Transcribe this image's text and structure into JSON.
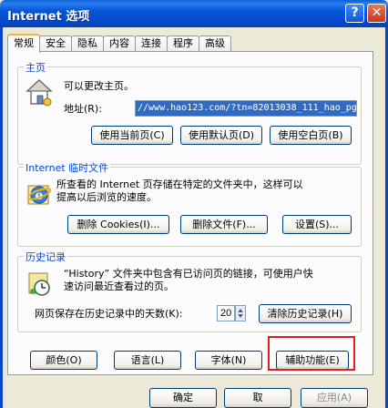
{
  "window": {
    "title": "Internet 选项",
    "help_glyph": "?",
    "close_glyph": "✕"
  },
  "tabs": [
    {
      "label": "常规",
      "active": true
    },
    {
      "label": "安全"
    },
    {
      "label": "隐私"
    },
    {
      "label": "内容"
    },
    {
      "label": "连接"
    },
    {
      "label": "程序"
    },
    {
      "label": "高级"
    }
  ],
  "homepage": {
    "group_label": "主页",
    "description": "可以更改主页。",
    "address_label": "地址(R):",
    "address_value": "//www.hao123.com/?tn=82013038_111_hao_pg",
    "btn_current": "使用当前页(C)",
    "btn_default": "使用默认页(D)",
    "btn_blank": "使用空白页(B)"
  },
  "temp_files": {
    "group_label": "Internet 临时文件",
    "description_line1": "所查看的 Internet 页存储在特定的文件夹中，这样可以",
    "description_line2": "提高以后浏览的速度。",
    "btn_delete_cookies": "删除 Cookies(I)...",
    "btn_delete_files": "删除文件(F)...",
    "btn_settings": "设置(S)..."
  },
  "history": {
    "group_label": "历史记录",
    "description_line1": "“History” 文件夹中包含有已访问页的链接，可使用户快",
    "description_line2": "速访问最近查看过的页。",
    "days_label": "网页保存在历史记录中的天数(K):",
    "days_value": "20",
    "btn_clear": "清除历史记录(H)"
  },
  "bottom_buttons": {
    "colors": "颜色(O)",
    "languages": "语言(L)",
    "fonts": "字体(N)",
    "accessibility": "辅助功能(E)"
  },
  "dialog_buttons": {
    "ok": "确定",
    "cancel": "取",
    "apply": "应用(A)"
  },
  "colors": {
    "title_bar": "#0755d8",
    "highlight_box": "#e02020",
    "group_label": "#0046d5"
  },
  "icons": [
    "house-icon",
    "ie-globe-icon",
    "history-clock-icon"
  ]
}
